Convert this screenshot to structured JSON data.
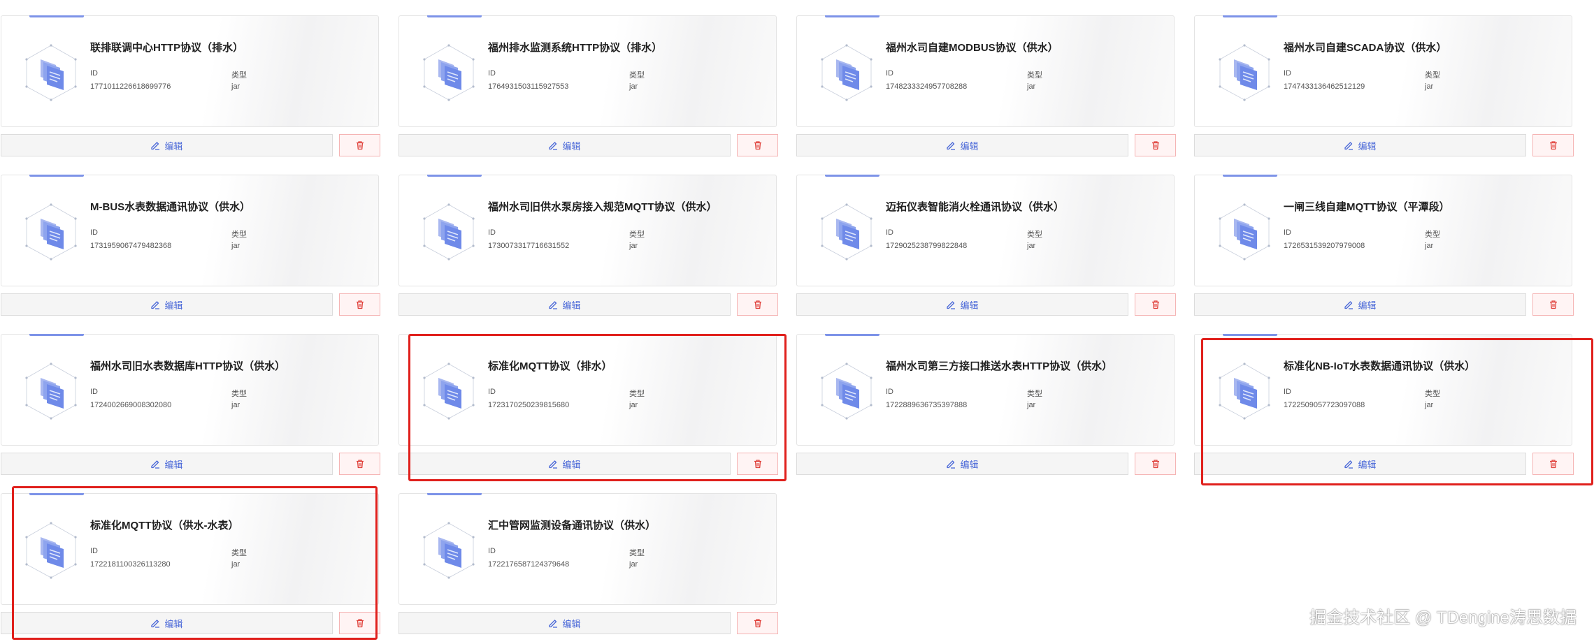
{
  "buttons": {
    "edit_label": "编辑"
  },
  "fields": {
    "id_label": "ID",
    "type_label": "类型"
  },
  "cards": [
    {
      "name": "联排联调中心HTTP协议（排水）",
      "id": "1771011226618699776",
      "type": "jar"
    },
    {
      "name": "福州排水监测系统HTTP协议（排水）",
      "id": "1764931503115927553",
      "type": "jar"
    },
    {
      "name": "福州水司自建MODBUS协议（供水）",
      "id": "1748233324957708288",
      "type": "jar"
    },
    {
      "name": "福州水司自建SCADA协议（供水）",
      "id": "1747433136462512129",
      "type": "jar"
    },
    {
      "name": "M-BUS水表数据通讯协议（供水）",
      "id": "1731959067479482368",
      "type": "jar"
    },
    {
      "name": "福州水司旧供水泵房接入规范MQTT协议（供水）",
      "id": "1730073317716631552",
      "type": "jar"
    },
    {
      "name": "迈拓仪表智能消火栓通讯协议（供水）",
      "id": "1729025238799822848",
      "type": "jar"
    },
    {
      "name": "一闸三线自建MQTT协议（平潭段）",
      "id": "1726531539207979008",
      "type": "jar"
    },
    {
      "name": "福州水司旧水表数据库HTTP协议（供水）",
      "id": "1724002669008302080",
      "type": "jar"
    },
    {
      "name": "标准化MQTT协议（排水）",
      "id": "1723170250239815680",
      "type": "jar"
    },
    {
      "name": "福州水司第三方接口推送水表HTTP协议（供水）",
      "id": "1722889636735397888",
      "type": "jar"
    },
    {
      "name": "标准化NB-IoT水表数据通讯协议（供水）",
      "id": "1722509057723097088",
      "type": "jar"
    },
    {
      "name": "标准化MQTT协议（供水-水表）",
      "id": "1722181100326113280",
      "type": "jar"
    },
    {
      "name": "汇中管网监测设备通讯协议（供水）",
      "id": "1722176587124379648",
      "type": "jar"
    }
  ],
  "watermark": "掘金技术社区 @ TDengine涛思数据",
  "colors": {
    "accent": "#7d93e8",
    "edit_text": "#4a68d8",
    "delete_icon": "#e0403a",
    "highlight": "#e0201c"
  },
  "icons": {
    "card": "document-cube-icon",
    "edit": "pencil-icon",
    "delete": "trash-icon"
  }
}
